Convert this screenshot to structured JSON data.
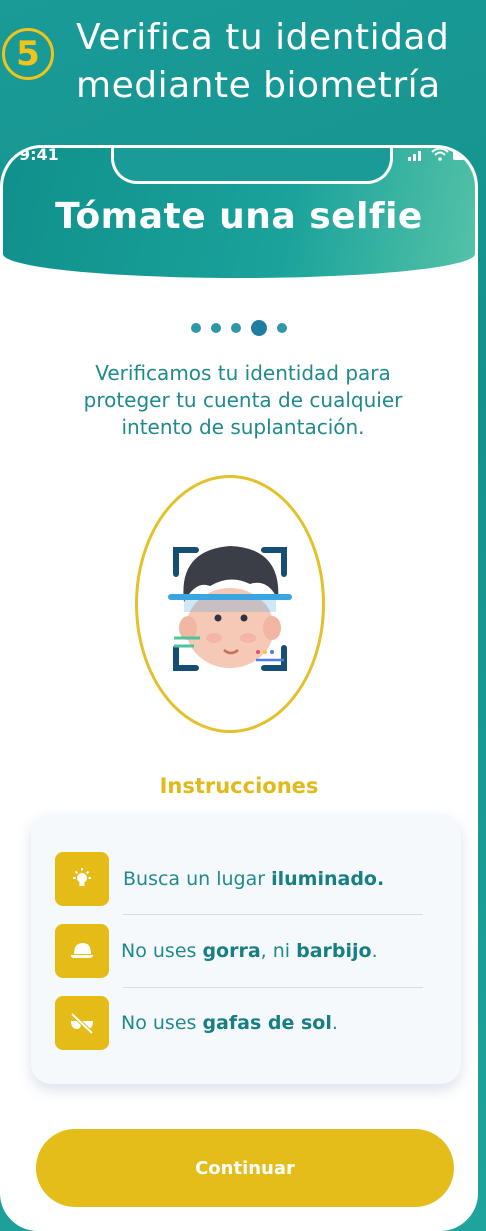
{
  "step": {
    "number": "5",
    "title": "Verifica tu identidad mediante biometría"
  },
  "status_bar": {
    "time": "9:41",
    "icons": [
      "signal-icon",
      "wifi-icon",
      "battery-icon"
    ]
  },
  "screen": {
    "title": "Tómate una selfie",
    "progress": {
      "total": 5,
      "current": 4
    },
    "intro": "Verificamos tu identidad para proteger tu cuenta de cualquier intento de suplantación."
  },
  "instructions": {
    "title": "Instrucciones",
    "items": [
      {
        "icon": "light-bulb-icon",
        "pre": "Busca un lugar ",
        "bold1": "iluminado.",
        "mid": "",
        "bold2": "",
        "post": ""
      },
      {
        "icon": "cap-icon",
        "pre": "No uses ",
        "bold1": "gorra",
        "mid": ", ni ",
        "bold2": "barbijo",
        "post": "."
      },
      {
        "icon": "no-sunglasses-icon",
        "pre": "No uses ",
        "bold1": "gafas de sol",
        "mid": "",
        "bold2": "",
        "post": "."
      }
    ]
  },
  "button": {
    "label": "Continuar"
  },
  "colors": {
    "teal": "#1a9b97",
    "accent": "#e4bd1a",
    "text": "#1f8a8c"
  }
}
